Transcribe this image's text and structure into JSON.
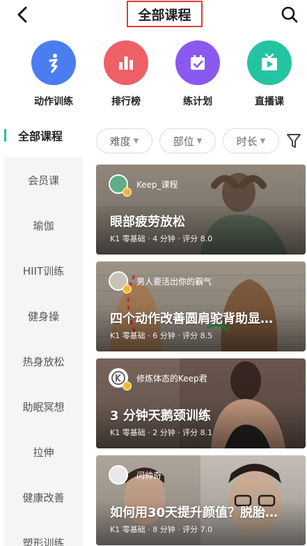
{
  "header": {
    "title": "全部课程",
    "back_icon": "back-arrow-icon",
    "search_icon": "search-icon",
    "highlight_color": "#e53935"
  },
  "quick_categories": [
    {
      "label": "动作训练",
      "icon": "runner-icon",
      "color": "#4a7ef0"
    },
    {
      "label": "排行榜",
      "icon": "bar-chart-icon",
      "color": "#ef5f66"
    },
    {
      "label": "练计划",
      "icon": "calendar-check-icon",
      "color": "#8a5af0"
    },
    {
      "label": "直播课",
      "icon": "tv-icon",
      "color": "#24c4a0"
    }
  ],
  "sidebar": {
    "active": "全部课程",
    "accent_color": "#24c789",
    "items": [
      {
        "label": "会员课"
      },
      {
        "label": "瑜伽"
      },
      {
        "label": "HIIT训练"
      },
      {
        "label": "健身操"
      },
      {
        "label": "热身放松"
      },
      {
        "label": "助眠冥想"
      },
      {
        "label": "拉伸"
      },
      {
        "label": "健康改善"
      },
      {
        "label": "塑形训练"
      }
    ]
  },
  "filters": [
    {
      "label": "难度"
    },
    {
      "label": "部位"
    },
    {
      "label": "时长"
    }
  ],
  "filter_icon": "funnel-icon",
  "courses": [
    {
      "author": "Keep_课程",
      "title": "眼部疲劳放松",
      "meta": "K1 零基础 · 4 分钟 · 评分 8.0",
      "bg": "#8a8176"
    },
    {
      "author": "男人要活出你的霸气",
      "title": "四个动作改善圆肩驼背助显…",
      "meta": "K1 零基础 · 6 分钟 · 评分 8.5",
      "bg": "#9c9589"
    },
    {
      "author": "修炼体态的Keep君",
      "title": "3 分钟天鹅颈训练",
      "meta": "K1 零基础 · 2 分钟 · 评分 8.1",
      "bg": "#6f5b52"
    },
    {
      "author": "闫帅奇",
      "title": "如何用30天提升颜值？脱胎…",
      "meta": "K1 零基础 · 8 分钟 · 评分 7.0",
      "bg": "#b8aea4"
    }
  ]
}
